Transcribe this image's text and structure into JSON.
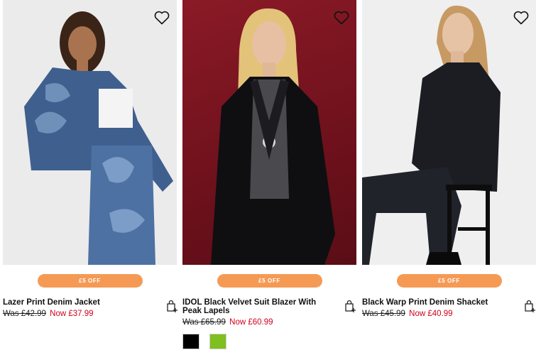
{
  "products": [
    {
      "badge": "£5 OFF",
      "title": "Lazer Print Denim Jacket",
      "was_price": "Was £42.99",
      "now_price": "Now £37.99"
    },
    {
      "badge": "£5 OFF",
      "title": "IDOL Black Velvet Suit Blazer With Peak Lapels",
      "was_price": "Was £65.99",
      "now_price": "Now £60.99",
      "swatches": [
        {
          "color": "#000000"
        },
        {
          "color": "#7fbf1f"
        }
      ]
    },
    {
      "badge": "£5 OFF",
      "title": "Black Warp Print Denim Shacket",
      "was_price": "Was £45.99",
      "now_price": "Now £40.99"
    }
  ],
  "colors": {
    "badge": "#f59a55",
    "sale_price": "#d0021b",
    "image_bg_2": "#7a1520"
  },
  "icons": {
    "wishlist": "heart-outline-icon",
    "add_to_bag": "bag-plus-icon"
  }
}
